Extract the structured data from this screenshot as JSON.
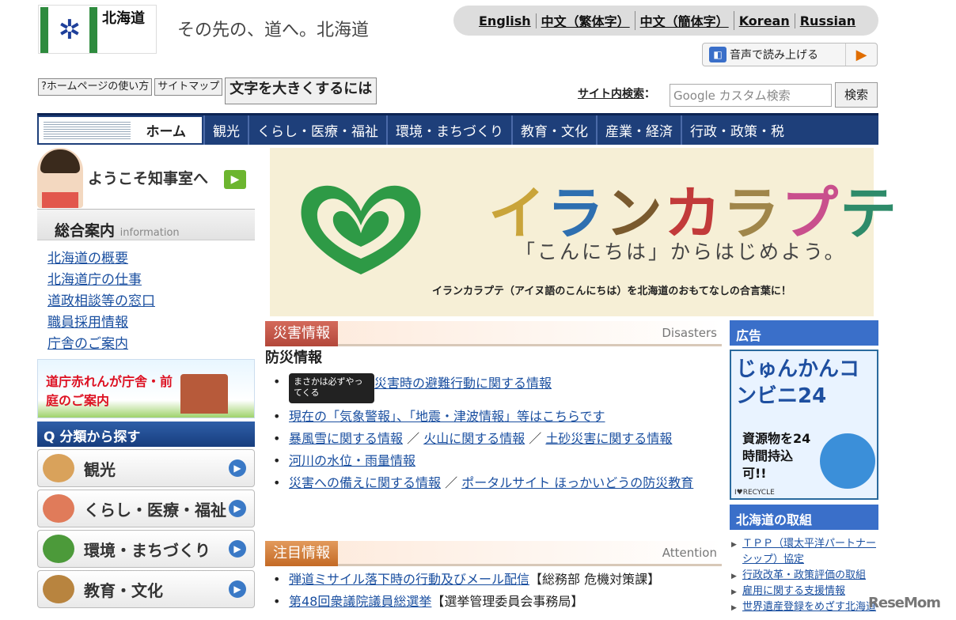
{
  "header": {
    "logo_text": "北海道",
    "tagline": "その先の、道へ。北海道",
    "languages": [
      "English",
      "中文（繁体字）",
      "中文（簡体字）",
      "Korean",
      "Russian"
    ],
    "speech_label": "音声で読み上げる"
  },
  "toolbar": {
    "guide": "?ホームページの使い方",
    "sitemap": "サイトマップ",
    "textsize": "文字を大きくするには",
    "search_label": "サイト内検索",
    "search_placeholder": "Google カスタム検索",
    "search_button": "検索"
  },
  "nav": {
    "items": [
      "ホーム",
      "観光",
      "くらし・医療・福祉",
      "環境・まちづくり",
      "教育・文化",
      "産業・経済",
      "行政・政策・税"
    ]
  },
  "sidebar": {
    "welcome": "ようこそ知事室へ",
    "info_title": "総合案内",
    "info_sub": "information",
    "info_links": [
      "北海道の概要",
      "北海道庁の仕事",
      "道政相談等の窓口",
      "職員採用情報",
      "庁舎のご案内"
    ],
    "bricks": "道庁赤れんが庁舎・前庭のご案内",
    "category_title": "分類から探す",
    "categories": [
      "観光",
      "くらし・医療・福祉",
      "環境・まちづくり",
      "教育・文化"
    ]
  },
  "banner": {
    "title": "イランカラプテ",
    "subtitle": "「こんにちは」からはじめよう。",
    "note": "イランカラプテ（アイヌ語のこんにちは）を北海道のおもてなしの合言葉に！"
  },
  "disasters": {
    "tab": "災害情報",
    "en": "Disasters",
    "subheading": "防災情報",
    "badge": "まさかは必ずやってくる",
    "items": [
      "災害時の避難行動に関する情報",
      "現在の「気象警報」、「地震・津波情報」等はこちらです",
      "暴風雪に関する情報",
      "火山に関する情報",
      "土砂災害に関する情報",
      "河川の水位・雨量情報",
      "災害への備えに関する情報",
      "ポータルサイト ほっかいどうの防災教育"
    ],
    "sep": " ／ "
  },
  "attention": {
    "tab": "注目情報",
    "en": "Attention",
    "items": [
      {
        "link": "弾道ミサイル落下時の行動及びメール配信",
        "org": "【総務部 危機対策課】"
      },
      {
        "link": "第48回衆議院議員総選挙",
        "org": "【選挙管理委員会事務局】"
      }
    ]
  },
  "ads": {
    "title": "広告",
    "big": "じゅんかんコンビニ24",
    "small": "資源物を24時間持込可!!",
    "recycle": "I♥RECYCLE"
  },
  "initiatives": {
    "title": "北海道の取組",
    "links": [
      "ＴＰＰ（環太平洋パートナーシップ）協定",
      "行政改革・政策評価の取組",
      "雇用に関する支援情報",
      "世界遺産登録をめざす北海道"
    ]
  },
  "watermark": "ReseMom",
  "colors": {
    "nav": "#1e3f7a",
    "disaster_tab": "#b3473a",
    "attention_tab": "#c46a25",
    "sidebar_blue": "#3a6fc9"
  }
}
